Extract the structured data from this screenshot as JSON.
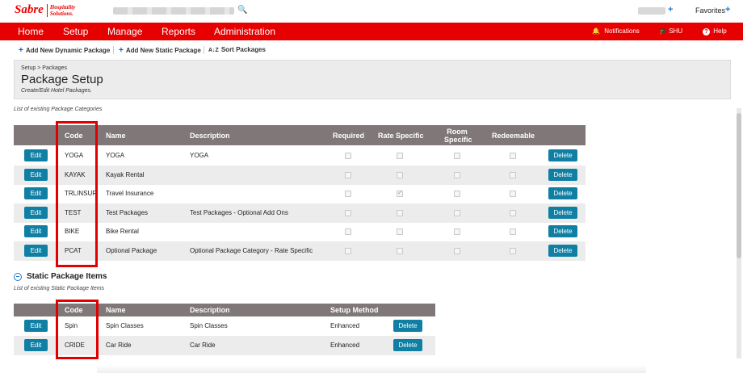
{
  "brand": {
    "name": "Sabre",
    "sub_line1": "Hospitality",
    "sub_line2": "Solutions."
  },
  "topbar": {
    "favorites": "Favorites",
    "plus": "+",
    "search_icon": "search-icon"
  },
  "nav": {
    "items": [
      "Home",
      "Setup",
      "Manage",
      "Reports",
      "Administration"
    ],
    "active": "Setup",
    "right": [
      {
        "label": "Notifications",
        "icon": "bell-icon"
      },
      {
        "label": "SHU",
        "icon": "graduation-cap-icon"
      },
      {
        "label": "Help",
        "icon": "question-icon"
      }
    ]
  },
  "actions": [
    {
      "label": "Add New Dynamic Package",
      "icon": "plus-icon"
    },
    {
      "label": "Add New Static Package",
      "icon": "plus-icon"
    },
    {
      "label": "Sort Packages",
      "icon": "sort-az-icon"
    }
  ],
  "header": {
    "breadcrumb": "Setup > Packages",
    "title": "Package Setup",
    "subtitle": "Create/Edit Hotel Packages."
  },
  "categories": {
    "caption": "List of existing Package Categories",
    "columns": [
      "Code",
      "Name",
      "Description",
      "Required",
      "Rate Specific",
      "Room Specific",
      "Redeemable"
    ],
    "room_specific_line1": "Room",
    "room_specific_line2": "Specific",
    "edit_label": "Edit",
    "delete_label": "Delete",
    "rows": [
      {
        "code": "YOGA",
        "name": "YOGA",
        "description": "YOGA",
        "required": false,
        "rate": false,
        "room": false,
        "redeem": false
      },
      {
        "code": "KAYAK",
        "name": "Kayak Rental",
        "description": "",
        "required": false,
        "rate": false,
        "room": false,
        "redeem": false
      },
      {
        "code": "TRLINSUR",
        "name": "Travel Insurance",
        "description": "",
        "required": false,
        "rate": true,
        "room": false,
        "redeem": false
      },
      {
        "code": "TEST",
        "name": "Test Packages",
        "description": "Test Packages - Optional Add Ons",
        "required": false,
        "rate": false,
        "room": false,
        "redeem": false
      },
      {
        "code": "BIKE",
        "name": "Bike Rental",
        "description": "",
        "required": false,
        "rate": false,
        "room": false,
        "redeem": false
      },
      {
        "code": "PCAT",
        "name": "Optional Package",
        "description": "Optional Package Category - Rate Specific",
        "required": false,
        "rate": false,
        "room": false,
        "redeem": false
      }
    ]
  },
  "static": {
    "title": "Static Package Items",
    "caption": "List of existing Static Package Items",
    "columns": [
      "Code",
      "Name",
      "Description",
      "Setup Method"
    ],
    "edit_label": "Edit",
    "delete_label": "Delete",
    "rows": [
      {
        "code": "Spin",
        "name": "Spin Classes",
        "description": "Spin Classes",
        "method": "Enhanced"
      },
      {
        "code": "CRIDE",
        "name": "Car Ride",
        "description": "Car Ride",
        "method": "Enhanced"
      }
    ]
  },
  "colors": {
    "brand_red": "#e60000",
    "button_teal": "#0f7fa3",
    "header_gray": "#807878",
    "highlight_red": "#e00000"
  }
}
